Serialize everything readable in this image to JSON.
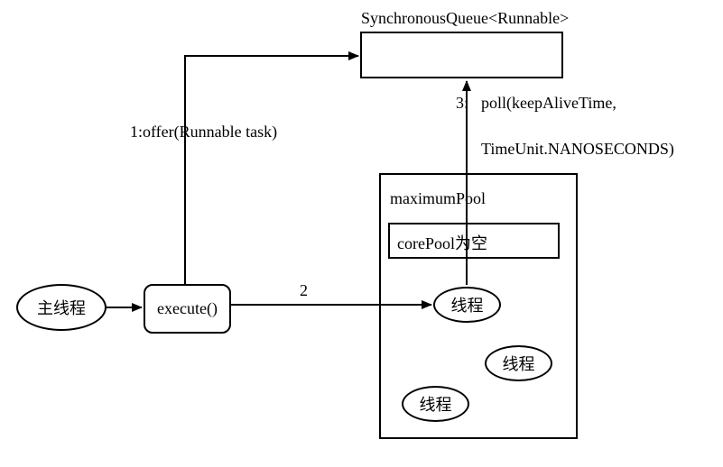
{
  "queue": {
    "title": "SynchronousQueue<Runnable>"
  },
  "edges": {
    "offer": "1:offer(Runnable task)",
    "two": "2",
    "poll_num": "3:",
    "poll_line1": "poll(keepAliveTime,",
    "poll_line2": "TimeUnit.NANOSECONDS)"
  },
  "nodes": {
    "main_thread": "主线程",
    "execute": "execute()",
    "maximum_pool": "maximumPool",
    "core_pool": "corePool为空",
    "thread": "线程"
  }
}
